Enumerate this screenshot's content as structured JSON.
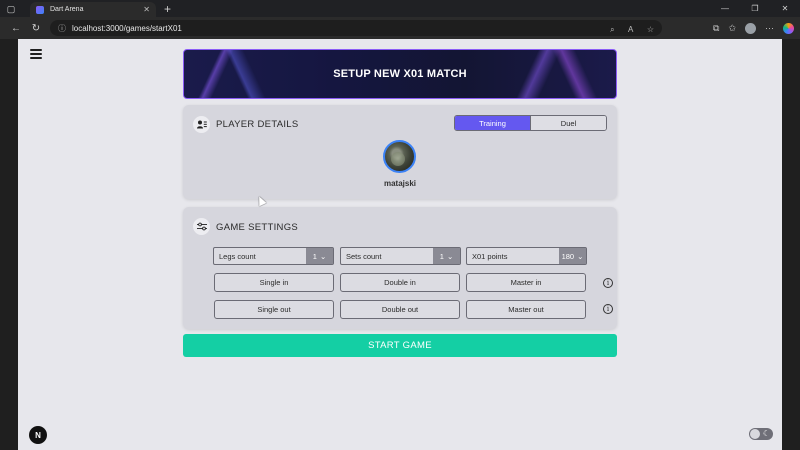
{
  "browser": {
    "tab_title": "Dart Arena",
    "tab_close": "✕",
    "new_tab": "+",
    "url": "localhost:3000/games/startX01",
    "window_controls": {
      "minimize": "—",
      "restore": "❐",
      "close": "✕"
    }
  },
  "page": {
    "banner_title": "SETUP NEW X01 MATCH",
    "player_details": {
      "title": "PLAYER DETAILS",
      "mode_options": [
        "Training",
        "Duel"
      ],
      "selected_mode": "Training",
      "player_name": "matajski"
    },
    "game_settings": {
      "title": "GAME SETTINGS",
      "legs": {
        "label": "Legs count",
        "value": "1"
      },
      "sets": {
        "label": "Sets count",
        "value": "1"
      },
      "points": {
        "label": "X01 points",
        "value": "180"
      },
      "in_options": [
        "Single in",
        "Double in",
        "Master in"
      ],
      "out_options": [
        "Single out",
        "Double out",
        "Master out"
      ],
      "info_glyph": "i"
    },
    "start_button": "START GAME",
    "next_badge": "N"
  },
  "colors": {
    "accent": "#6458f0",
    "start_button": "#14cfa4",
    "banner_border": "#8b5cf6",
    "card_bg": "#d6d6dd",
    "page_bg": "#e7e7ec"
  },
  "icons": [
    "menu-icon",
    "user-list-icon",
    "sliders-icon",
    "info-icon",
    "chevron-down-icon",
    "moon-icon"
  ]
}
